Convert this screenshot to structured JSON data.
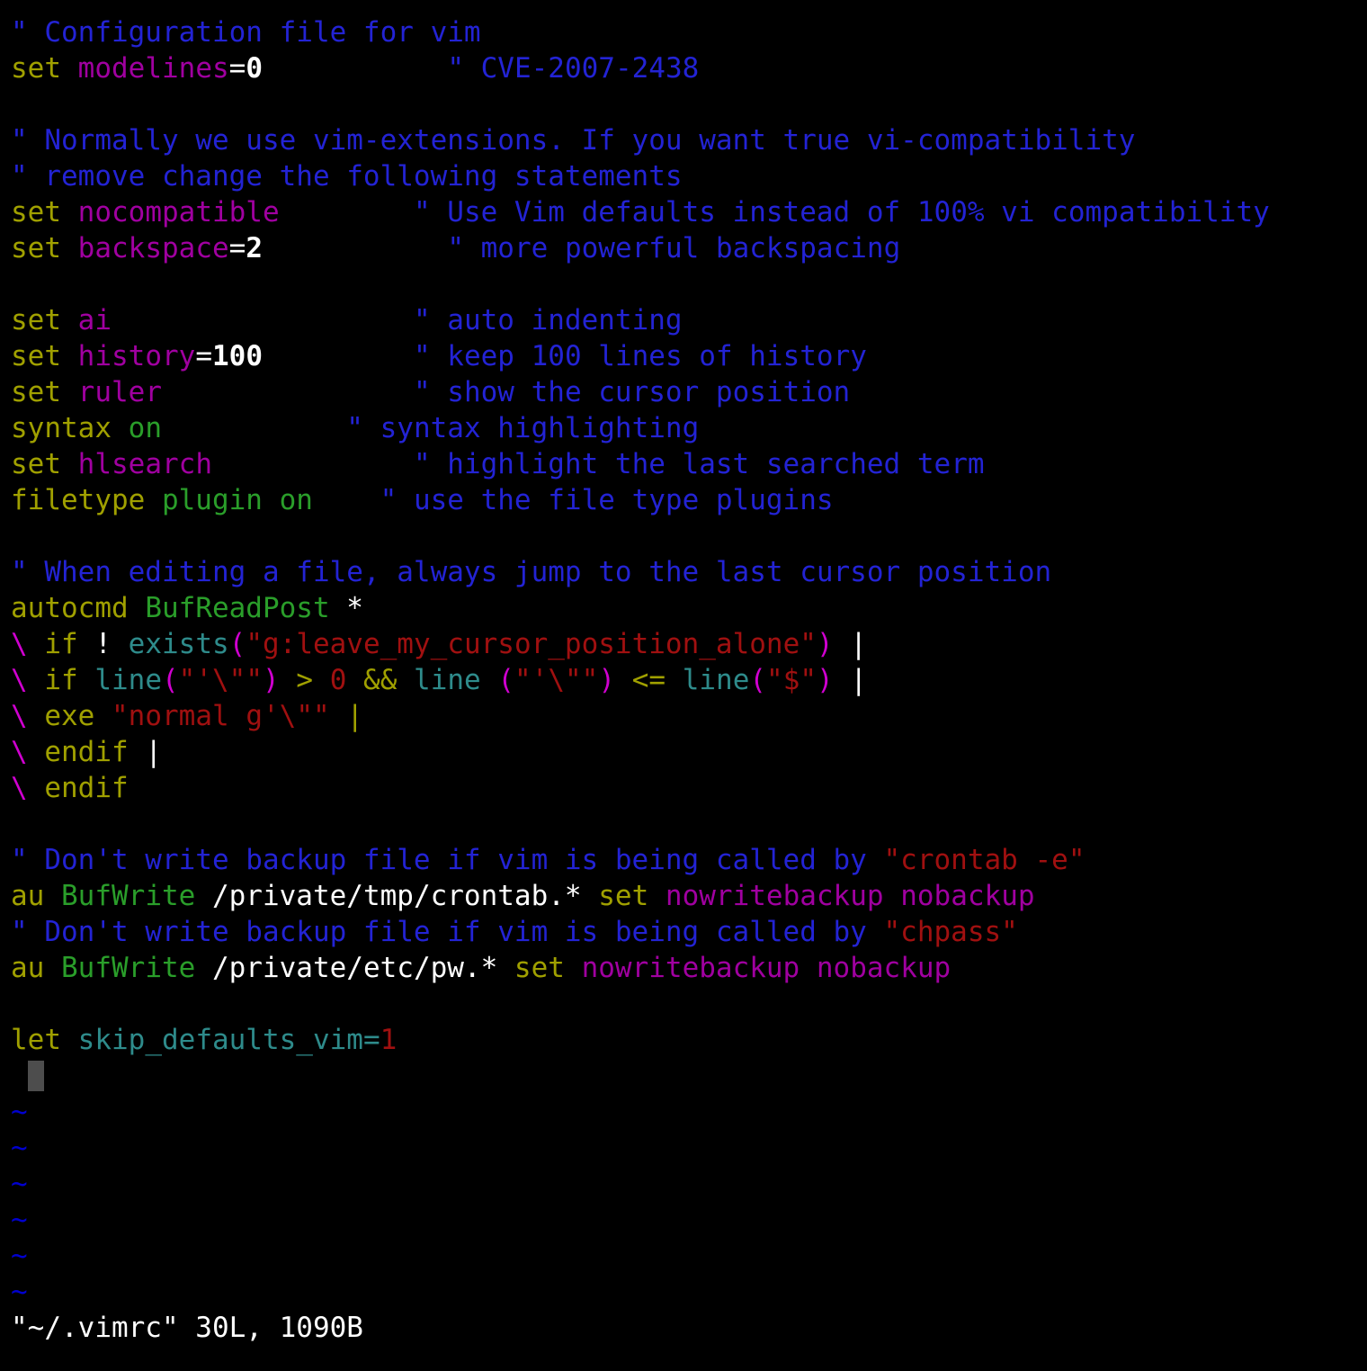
{
  "editor": {
    "app": "vim",
    "filename": "~/.vimrc",
    "colors": {
      "background": "#000000",
      "comment": "#2323d4",
      "statement": "#a0a000",
      "option": "#a000a0",
      "string": "#a01010",
      "identifier": "#2e8b8b",
      "type": "#2a9e2a",
      "paren": "#d000d0",
      "normal": "#ffffff",
      "tilde": "#0000d0",
      "cursor": "#4d4d4d"
    },
    "statusline": "\"~/.vimrc\" 30L, 1090B",
    "status_parts": {
      "file": "\"~/.vimrc\"",
      "lines": "30L,",
      "bytes": "1090B"
    }
  },
  "lines": [
    {
      "n": 1,
      "tokens": [
        {
          "t": "\" Configuration file for vim",
          "c": "comment"
        }
      ]
    },
    {
      "n": 2,
      "tokens": [
        {
          "t": "set",
          "c": "statement"
        },
        {
          "t": " ",
          "c": "normal"
        },
        {
          "t": "modelines",
          "c": "option"
        },
        {
          "t": "=",
          "c": "normal"
        },
        {
          "t": "0",
          "c": "number"
        },
        {
          "t": "           ",
          "c": "normal"
        },
        {
          "t": "\" CVE-2007-2438",
          "c": "comment"
        }
      ]
    },
    {
      "n": 3,
      "tokens": []
    },
    {
      "n": 4,
      "tokens": [
        {
          "t": "\" Normally we use vim-extensions. If you want true vi-compatibility",
          "c": "comment"
        }
      ]
    },
    {
      "n": 5,
      "tokens": [
        {
          "t": "\" remove change the following statements",
          "c": "comment"
        }
      ]
    },
    {
      "n": 6,
      "tokens": [
        {
          "t": "set",
          "c": "statement"
        },
        {
          "t": " ",
          "c": "normal"
        },
        {
          "t": "nocompatible",
          "c": "option"
        },
        {
          "t": "        ",
          "c": "normal"
        },
        {
          "t": "\" Use Vim defaults instead of 100% vi compatibility",
          "c": "comment"
        }
      ]
    },
    {
      "n": 7,
      "tokens": [
        {
          "t": "set",
          "c": "statement"
        },
        {
          "t": " ",
          "c": "normal"
        },
        {
          "t": "backspace",
          "c": "option"
        },
        {
          "t": "=",
          "c": "normal"
        },
        {
          "t": "2",
          "c": "number"
        },
        {
          "t": "           ",
          "c": "normal"
        },
        {
          "t": "\" more powerful backspacing",
          "c": "comment"
        }
      ]
    },
    {
      "n": 8,
      "tokens": []
    },
    {
      "n": 9,
      "tokens": [
        {
          "t": "set",
          "c": "statement"
        },
        {
          "t": " ",
          "c": "normal"
        },
        {
          "t": "ai",
          "c": "option"
        },
        {
          "t": "                  ",
          "c": "normal"
        },
        {
          "t": "\" auto indenting",
          "c": "comment"
        }
      ]
    },
    {
      "n": 10,
      "tokens": [
        {
          "t": "set",
          "c": "statement"
        },
        {
          "t": " ",
          "c": "normal"
        },
        {
          "t": "history",
          "c": "option"
        },
        {
          "t": "=",
          "c": "normal"
        },
        {
          "t": "100",
          "c": "number"
        },
        {
          "t": "         ",
          "c": "normal"
        },
        {
          "t": "\" keep 100 lines of history",
          "c": "comment"
        }
      ]
    },
    {
      "n": 11,
      "tokens": [
        {
          "t": "set",
          "c": "statement"
        },
        {
          "t": " ",
          "c": "normal"
        },
        {
          "t": "ruler",
          "c": "option"
        },
        {
          "t": "               ",
          "c": "normal"
        },
        {
          "t": "\" show the cursor position",
          "c": "comment"
        }
      ]
    },
    {
      "n": 12,
      "tokens": [
        {
          "t": "syntax",
          "c": "statement"
        },
        {
          "t": " ",
          "c": "normal"
        },
        {
          "t": "on",
          "c": "type"
        },
        {
          "t": "           ",
          "c": "normal"
        },
        {
          "t": "\" syntax highlighting",
          "c": "comment"
        }
      ]
    },
    {
      "n": 13,
      "tokens": [
        {
          "t": "set",
          "c": "statement"
        },
        {
          "t": " ",
          "c": "normal"
        },
        {
          "t": "hlsearch",
          "c": "option"
        },
        {
          "t": "            ",
          "c": "normal"
        },
        {
          "t": "\" highlight the last searched term",
          "c": "comment"
        }
      ]
    },
    {
      "n": 14,
      "tokens": [
        {
          "t": "filetype",
          "c": "statement"
        },
        {
          "t": " ",
          "c": "normal"
        },
        {
          "t": "plugin on",
          "c": "type"
        },
        {
          "t": "    ",
          "c": "normal"
        },
        {
          "t": "\" use the file type plugins",
          "c": "comment"
        }
      ]
    },
    {
      "n": 15,
      "tokens": []
    },
    {
      "n": 16,
      "tokens": [
        {
          "t": "\" When editing a file, always jump to the last cursor position",
          "c": "comment"
        }
      ]
    },
    {
      "n": 17,
      "tokens": [
        {
          "t": "autocmd",
          "c": "statement"
        },
        {
          "t": " ",
          "c": "normal"
        },
        {
          "t": "BufReadPost",
          "c": "type"
        },
        {
          "t": " *",
          "c": "normal"
        }
      ]
    },
    {
      "n": 18,
      "tokens": [
        {
          "t": "\\",
          "c": "cont"
        },
        {
          "t": " ",
          "c": "normal"
        },
        {
          "t": "if",
          "c": "statement"
        },
        {
          "t": " ! ",
          "c": "normal"
        },
        {
          "t": "exists",
          "c": "ident"
        },
        {
          "t": "(",
          "c": "paren"
        },
        {
          "t": "\"g:leave_my_cursor_position_alone\"",
          "c": "string"
        },
        {
          "t": ")",
          "c": "paren"
        },
        {
          "t": " |",
          "c": "normal"
        }
      ]
    },
    {
      "n": 19,
      "tokens": [
        {
          "t": "\\",
          "c": "cont"
        },
        {
          "t": " ",
          "c": "normal"
        },
        {
          "t": "if",
          "c": "statement"
        },
        {
          "t": " ",
          "c": "normal"
        },
        {
          "t": "line",
          "c": "ident"
        },
        {
          "t": "(",
          "c": "paren"
        },
        {
          "t": "\"'\\\"\"",
          "c": "string"
        },
        {
          "t": ")",
          "c": "paren"
        },
        {
          "t": " ",
          "c": "normal"
        },
        {
          "t": ">",
          "c": "oper"
        },
        {
          "t": " ",
          "c": "normal"
        },
        {
          "t": "0",
          "c": "string"
        },
        {
          "t": " ",
          "c": "normal"
        },
        {
          "t": "&&",
          "c": "oper"
        },
        {
          "t": " ",
          "c": "normal"
        },
        {
          "t": "line",
          "c": "ident"
        },
        {
          "t": " ",
          "c": "normal"
        },
        {
          "t": "(",
          "c": "paren"
        },
        {
          "t": "\"'\\\"\"",
          "c": "string"
        },
        {
          "t": ")",
          "c": "paren"
        },
        {
          "t": " ",
          "c": "normal"
        },
        {
          "t": "<=",
          "c": "oper"
        },
        {
          "t": " ",
          "c": "normal"
        },
        {
          "t": "line",
          "c": "ident"
        },
        {
          "t": "(",
          "c": "paren"
        },
        {
          "t": "\"$\"",
          "c": "string"
        },
        {
          "t": ")",
          "c": "paren"
        },
        {
          "t": " |",
          "c": "normal"
        }
      ]
    },
    {
      "n": 20,
      "tokens": [
        {
          "t": "\\",
          "c": "cont"
        },
        {
          "t": " ",
          "c": "normal"
        },
        {
          "t": "exe",
          "c": "statement"
        },
        {
          "t": " ",
          "c": "normal"
        },
        {
          "t": "\"normal g'\\\"\"",
          "c": "string"
        },
        {
          "t": " ",
          "c": "normal"
        },
        {
          "t": "|",
          "c": "oper"
        }
      ]
    },
    {
      "n": 21,
      "tokens": [
        {
          "t": "\\",
          "c": "cont"
        },
        {
          "t": " ",
          "c": "normal"
        },
        {
          "t": "endif",
          "c": "statement"
        },
        {
          "t": " |",
          "c": "normal"
        }
      ]
    },
    {
      "n": 22,
      "tokens": [
        {
          "t": "\\",
          "c": "cont"
        },
        {
          "t": " ",
          "c": "normal"
        },
        {
          "t": "endif",
          "c": "statement"
        }
      ]
    },
    {
      "n": 23,
      "tokens": []
    },
    {
      "n": 24,
      "tokens": [
        {
          "t": "\" Don't write backup file if vim is being called by ",
          "c": "comment"
        },
        {
          "t": "\"crontab -e\"",
          "c": "string"
        }
      ]
    },
    {
      "n": 25,
      "tokens": [
        {
          "t": "au",
          "c": "statement"
        },
        {
          "t": " ",
          "c": "normal"
        },
        {
          "t": "BufWrite",
          "c": "type"
        },
        {
          "t": " /private/tmp/crontab.* ",
          "c": "normal"
        },
        {
          "t": "set",
          "c": "statement"
        },
        {
          "t": " ",
          "c": "normal"
        },
        {
          "t": "nowritebackup nobackup",
          "c": "option"
        }
      ]
    },
    {
      "n": 26,
      "tokens": [
        {
          "t": "\" Don't write backup file if vim is being called by ",
          "c": "comment"
        },
        {
          "t": "\"chpass\"",
          "c": "string"
        }
      ]
    },
    {
      "n": 27,
      "tokens": [
        {
          "t": "au",
          "c": "statement"
        },
        {
          "t": " ",
          "c": "normal"
        },
        {
          "t": "BufWrite",
          "c": "type"
        },
        {
          "t": " /private/etc/pw.* ",
          "c": "normal"
        },
        {
          "t": "set",
          "c": "statement"
        },
        {
          "t": " ",
          "c": "normal"
        },
        {
          "t": "nowritebackup nobackup",
          "c": "option"
        }
      ]
    },
    {
      "n": 28,
      "tokens": []
    },
    {
      "n": 29,
      "tokens": [
        {
          "t": "let",
          "c": "statement"
        },
        {
          "t": " ",
          "c": "normal"
        },
        {
          "t": "skip_defaults_vim",
          "c": "ident"
        },
        {
          "t": "=",
          "c": "ident"
        },
        {
          "t": "1",
          "c": "string"
        }
      ]
    },
    {
      "n": 30,
      "tokens": [],
      "cursor": true
    }
  ],
  "tildes": [
    "~",
    "~",
    "~",
    "~",
    "~",
    "~"
  ]
}
